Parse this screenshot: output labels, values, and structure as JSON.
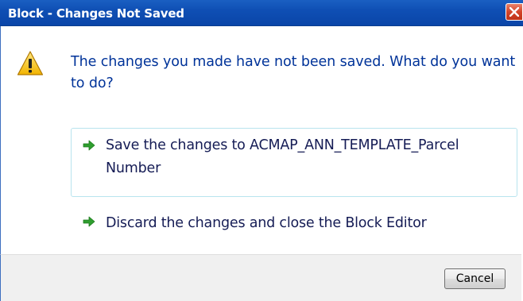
{
  "window": {
    "title": "Block - Changes Not Saved"
  },
  "dialog": {
    "icon": "warning-icon",
    "main_instruction": "The changes you made have not been saved. What do you want to do?",
    "options": [
      {
        "label": "Save the changes to ACMAP_ANN_TEMPLATE_Parcel Number",
        "icon": "green-arrow-icon",
        "selected": true
      },
      {
        "label": "Discard the changes and close the Block Editor",
        "icon": "green-arrow-icon",
        "selected": false
      }
    ]
  },
  "footer": {
    "cancel_label": "Cancel"
  },
  "colors": {
    "titlebar": "#0f4fb4",
    "instruction_text": "#003399",
    "link_text": "#151c55",
    "arrow": "#2f9e2f",
    "selected_border": "#b8e4ee",
    "close_button": "#d3452a"
  }
}
